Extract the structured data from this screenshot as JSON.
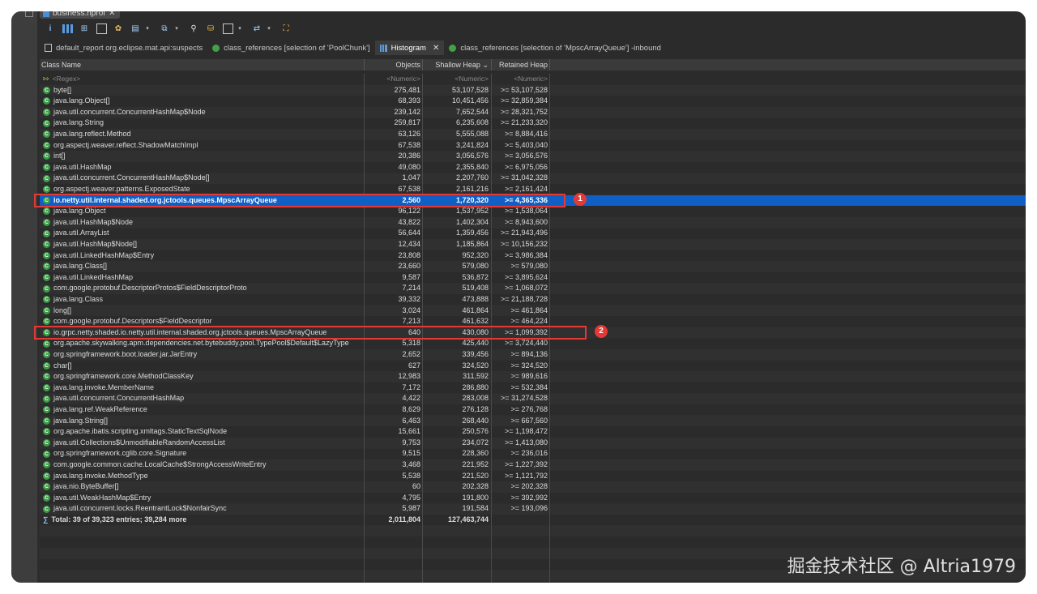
{
  "editor_tab": {
    "title": "business.hprof"
  },
  "view_tabs": [
    {
      "label": "default_report org.eclipse.mat.api:suspects",
      "icon": "report-icon",
      "active": false
    },
    {
      "label": "class_references  [selection of 'PoolChunk']",
      "icon": "class-references-icon",
      "active": false
    },
    {
      "label": "Histogram",
      "icon": "histogram-icon",
      "active": true,
      "close": "✕"
    },
    {
      "label": "class_references  [selection of 'MpscArrayQueue'] -inbound",
      "icon": "class-references-icon",
      "active": false
    }
  ],
  "columns": {
    "name": "Class Name",
    "objects": "Objects",
    "shallow": "Shallow Heap",
    "shallow_sort": "⌄",
    "retained": "Retained Heap"
  },
  "filter_row": {
    "name": "<Regex>",
    "objects": "<Numeric>",
    "shallow": "<Numeric>",
    "retained": "<Numeric>"
  },
  "rows": [
    {
      "name": "byte[]",
      "objects": "275,481",
      "shallow": "53,107,528",
      "retained": ">= 53,107,528"
    },
    {
      "name": "java.lang.Object[]",
      "objects": "68,393",
      "shallow": "10,451,456",
      "retained": ">= 32,859,384"
    },
    {
      "name": "java.util.concurrent.ConcurrentHashMap$Node",
      "objects": "239,142",
      "shallow": "7,652,544",
      "retained": ">= 28,321,752"
    },
    {
      "name": "java.lang.String",
      "objects": "259,817",
      "shallow": "6,235,608",
      "retained": ">= 21,233,320"
    },
    {
      "name": "java.lang.reflect.Method",
      "objects": "63,126",
      "shallow": "5,555,088",
      "retained": ">= 8,884,416"
    },
    {
      "name": "org.aspectj.weaver.reflect.ShadowMatchImpl",
      "objects": "67,538",
      "shallow": "3,241,824",
      "retained": ">= 5,403,040"
    },
    {
      "name": "int[]",
      "objects": "20,386",
      "shallow": "3,056,576",
      "retained": ">= 3,056,576"
    },
    {
      "name": "java.util.HashMap",
      "objects": "49,080",
      "shallow": "2,355,840",
      "retained": ">= 6,975,056"
    },
    {
      "name": "java.util.concurrent.ConcurrentHashMap$Node[]",
      "objects": "1,047",
      "shallow": "2,207,760",
      "retained": ">= 31,042,328"
    },
    {
      "name": "org.aspectj.weaver.patterns.ExposedState",
      "objects": "67,538",
      "shallow": "2,161,216",
      "retained": ">= 2,161,424"
    },
    {
      "name": "io.netty.util.internal.shaded.org.jctools.queues.MpscArrayQueue",
      "objects": "2,560",
      "shallow": "1,720,320",
      "retained": ">= 4,365,336"
    },
    {
      "name": "java.lang.Object",
      "objects": "96,122",
      "shallow": "1,537,952",
      "retained": ">= 1,538,064"
    },
    {
      "name": "java.util.HashMap$Node",
      "objects": "43,822",
      "shallow": "1,402,304",
      "retained": ">= 8,943,600"
    },
    {
      "name": "java.util.ArrayList",
      "objects": "56,644",
      "shallow": "1,359,456",
      "retained": ">= 21,943,496"
    },
    {
      "name": "java.util.HashMap$Node[]",
      "objects": "12,434",
      "shallow": "1,185,864",
      "retained": ">= 10,156,232"
    },
    {
      "name": "java.util.LinkedHashMap$Entry",
      "objects": "23,808",
      "shallow": "952,320",
      "retained": ">= 3,986,384"
    },
    {
      "name": "java.lang.Class[]",
      "objects": "23,660",
      "shallow": "579,080",
      "retained": ">= 579,080"
    },
    {
      "name": "java.util.LinkedHashMap",
      "objects": "9,587",
      "shallow": "536,872",
      "retained": ">= 3,895,624"
    },
    {
      "name": "com.google.protobuf.DescriptorProtos$FieldDescriptorProto",
      "objects": "7,214",
      "shallow": "519,408",
      "retained": ">= 1,068,072"
    },
    {
      "name": "java.lang.Class",
      "objects": "39,332",
      "shallow": "473,888",
      "retained": ">= 21,188,728"
    },
    {
      "name": "long[]",
      "objects": "3,024",
      "shallow": "461,864",
      "retained": ">= 461,864"
    },
    {
      "name": "com.google.protobuf.Descriptors$FieldDescriptor",
      "objects": "7,213",
      "shallow": "461,632",
      "retained": ">= 464,224"
    },
    {
      "name": "io.grpc.netty.shaded.io.netty.util.internal.shaded.org.jctools.queues.MpscArrayQueue",
      "objects": "640",
      "shallow": "430,080",
      "retained": ">= 1,099,392"
    },
    {
      "name": "org.apache.skywalking.apm.dependencies.net.bytebuddy.pool.TypePool$Default$LazyType",
      "objects": "5,318",
      "shallow": "425,440",
      "retained": ">= 3,724,440"
    },
    {
      "name": "org.springframework.boot.loader.jar.JarEntry",
      "objects": "2,652",
      "shallow": "339,456",
      "retained": ">= 894,136"
    },
    {
      "name": "char[]",
      "objects": "627",
      "shallow": "324,520",
      "retained": ">= 324,520"
    },
    {
      "name": "org.springframework.core.MethodClassKey",
      "objects": "12,983",
      "shallow": "311,592",
      "retained": ">= 989,616"
    },
    {
      "name": "java.lang.invoke.MemberName",
      "objects": "7,172",
      "shallow": "286,880",
      "retained": ">= 532,384"
    },
    {
      "name": "java.util.concurrent.ConcurrentHashMap",
      "objects": "4,422",
      "shallow": "283,008",
      "retained": ">= 31,274,528"
    },
    {
      "name": "java.lang.ref.WeakReference",
      "objects": "8,629",
      "shallow": "276,128",
      "retained": ">= 276,768"
    },
    {
      "name": "java.lang.String[]",
      "objects": "6,463",
      "shallow": "268,440",
      "retained": ">= 667,560"
    },
    {
      "name": "org.apache.ibatis.scripting.xmltags.StaticTextSqlNode",
      "objects": "15,661",
      "shallow": "250,576",
      "retained": ">= 1,198,472"
    },
    {
      "name": "java.util.Collections$UnmodifiableRandomAccessList",
      "objects": "9,753",
      "shallow": "234,072",
      "retained": ">= 1,413,080"
    },
    {
      "name": "org.springframework.cglib.core.Signature",
      "objects": "9,515",
      "shallow": "228,360",
      "retained": ">= 236,016"
    },
    {
      "name": "com.google.common.cache.LocalCache$StrongAccessWriteEntry",
      "objects": "3,468",
      "shallow": "221,952",
      "retained": ">= 1,227,392"
    },
    {
      "name": "java.lang.invoke.MethodType",
      "objects": "5,538",
      "shallow": "221,520",
      "retained": ">= 1,121,792"
    },
    {
      "name": "java.nio.ByteBuffer[]",
      "objects": "60",
      "shallow": "202,328",
      "retained": ">= 202,328"
    },
    {
      "name": "java.util.WeakHashMap$Entry",
      "objects": "4,795",
      "shallow": "191,800",
      "retained": ">= 392,992"
    },
    {
      "name": "java.util.concurrent.locks.ReentrantLock$NonfairSync",
      "objects": "5,987",
      "shallow": "191,584",
      "retained": ">= 193,096"
    }
  ],
  "total_row": {
    "name": "Total: 39 of 39,323 entries; 39,284 more",
    "objects": "2,011,804",
    "shallow": "127,463,744",
    "retained": ""
  },
  "selected_row_index": 10,
  "annotations": [
    {
      "label": "1",
      "row_index": 10
    },
    {
      "label": "2",
      "row_index": 22
    }
  ],
  "class_icon_glyph": "C",
  "colors": {
    "selection": "#0f5fc4",
    "annotation": "#e53935",
    "class_icon": "#3a9d44"
  },
  "watermark": "掘金技术社区 @ Altria1979"
}
